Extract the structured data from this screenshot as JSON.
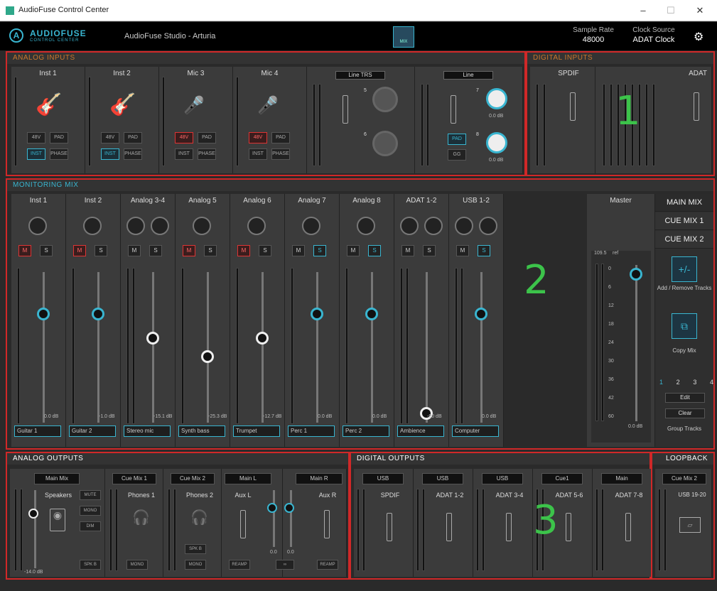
{
  "window": {
    "title": "AudioFuse Control Center",
    "minimize": "–",
    "maximize": "☐",
    "close": "✕"
  },
  "topbar": {
    "logo_title": "AUDIOFUSE",
    "logo_sub": "CONTROL CENTER",
    "project": "AudioFuse Studio - Arturia",
    "mix_label": "MIX",
    "sample_rate_label": "Sample Rate",
    "sample_rate": "48000",
    "clock_source_label": "Clock Source",
    "clock_source": "ADAT Clock"
  },
  "analog_inputs": {
    "header": "ANALOG INPUTS",
    "channels": [
      {
        "label": "Inst 1",
        "b1": "48V",
        "b2": "PAD",
        "b3": "INST",
        "b4": "PHASE"
      },
      {
        "label": "Inst 2",
        "b1": "48V",
        "b2": "PAD",
        "b3": "INST",
        "b4": "PHASE"
      },
      {
        "label": "Mic 3",
        "b1": "48V",
        "b2": "PAD",
        "b3": "INST",
        "b4": "PHASE"
      },
      {
        "label": "Mic 4",
        "b1": "48V",
        "b2": "PAD",
        "b3": "INST",
        "b4": "PHASE"
      }
    ],
    "line_trs": {
      "label": "Line TRS",
      "k1": "5",
      "k2": "6"
    },
    "line": {
      "label": "Line",
      "k1": "7",
      "k2": "8",
      "v1": "0.0 dB",
      "v2": "0.0 dB",
      "pad": "PAD",
      "gnd": "GG"
    }
  },
  "digital_inputs": {
    "header": "DIGITAL INPUTS",
    "spdif": "SPDIF",
    "adat": "ADAT"
  },
  "monitoring_mix": {
    "header": "MONITORING MIX",
    "m_label": "M",
    "s_label": "S",
    "channels": [
      {
        "label": "Inst 1",
        "db": "0.0 dB",
        "track": "Guitar 1"
      },
      {
        "label": "Inst 2",
        "db": "-1.0 dB",
        "track": "Guitar 2"
      },
      {
        "label": "Analog 3-4",
        "db": "-15.1 dB",
        "track": "Stereo mic"
      },
      {
        "label": "Analog 5",
        "db": "-25.3 dB",
        "track": "Synth bass"
      },
      {
        "label": "Analog 6",
        "db": "-12.7 dB",
        "track": "Trumpet"
      },
      {
        "label": "Analog 7",
        "db": "0.0 dB",
        "track": "Perc 1"
      },
      {
        "label": "Analog 8",
        "db": "0.0 dB",
        "track": "Perc 2"
      },
      {
        "label": "ADAT 1-2",
        "db": "-90 dB",
        "track": "Ambience"
      },
      {
        "label": "USB 1-2",
        "db": "0.0 dB",
        "track": "Computer"
      }
    ],
    "master": {
      "label": "Master",
      "db": "0.0 dB",
      "val1": "109.5",
      "val2": "ref",
      "scale": [
        "0",
        "6",
        "12",
        "18",
        "24",
        "30",
        "36",
        "42",
        "60"
      ]
    },
    "side": {
      "main_mix": "MAIN MIX",
      "cue1": "CUE MIX 1",
      "cue2": "CUE MIX 2",
      "add_icon": "+/-",
      "add_label": "Add / Remove Tracks",
      "copy_label": "Copy Mix",
      "pages": [
        "1",
        "2",
        "3",
        "4"
      ],
      "edit": "Edit",
      "clear": "Clear",
      "group": "Group Tracks"
    }
  },
  "analog_outputs": {
    "header": "ANALOG OUTPUTS",
    "main": {
      "tag": "Main Mix",
      "label": "Speakers",
      "b1": "MUTE",
      "b2": "MONO",
      "b3": "DIM",
      "b4": "SPK B",
      "db": "-14.0 dB"
    },
    "phones1": {
      "tag": "Cue Mix 1",
      "label": "Phones 1",
      "btn": "MONO"
    },
    "phones2": {
      "tag": "Cue Mix 2",
      "label": "Phones 2",
      "btn": "MONO",
      "btn2": "SPK B"
    },
    "auxl": {
      "tag": "Main L",
      "label": "Aux L",
      "btn": "REAMP"
    },
    "auxr": {
      "tag": "Main R",
      "label": "Aux R",
      "btn": "REAMP",
      "link": "∞",
      "v1": "0.0",
      "v2": "0.0"
    }
  },
  "digital_outputs": {
    "header": "DIGITAL OUTPUTS",
    "outs": [
      {
        "tag": "USB",
        "label": "SPDIF"
      },
      {
        "tag": "USB",
        "label": "ADAT 1-2"
      },
      {
        "tag": "USB",
        "label": "ADAT 3-4"
      },
      {
        "tag": "Cue1",
        "label": "ADAT 5-6"
      },
      {
        "tag": "Main",
        "label": "ADAT 7-8"
      }
    ]
  },
  "loopback": {
    "header": "LOOPBACK",
    "tag": "Cue Mix 2",
    "label": "USB 19-20"
  },
  "annotations": {
    "n1": "1",
    "n2": "2",
    "n3": "3"
  },
  "colors": {
    "accent": "#39b5d0",
    "section_border": "#d02828",
    "annotation": "#3cc34a",
    "analog_header": "#c8782c"
  }
}
